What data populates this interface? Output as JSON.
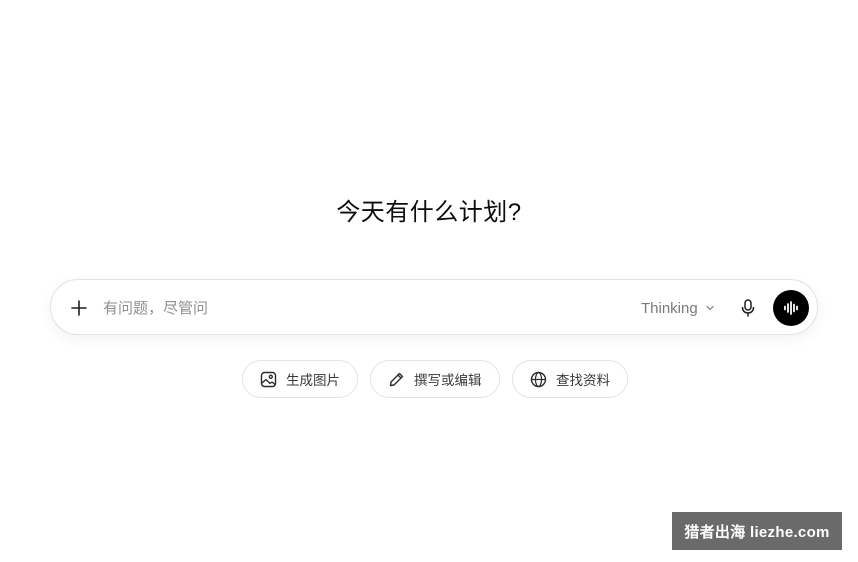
{
  "main": {
    "headline": "今天有什么计划?"
  },
  "composer": {
    "placeholder": "有问题，尽管问",
    "value": "",
    "model_label": "Thinking",
    "icons": {
      "add": "plus-icon",
      "model_dropdown": "chevron-down-icon",
      "dictate": "microphone-icon",
      "voice": "voice-waveform-icon"
    }
  },
  "suggestions": [
    {
      "label": "生成图片",
      "icon": "image-icon"
    },
    {
      "label": "撰写或编辑",
      "icon": "pencil-icon"
    },
    {
      "label": "查找资料",
      "icon": "globe-icon"
    }
  ],
  "watermark": {
    "text": "猎者出海 liezhe.com"
  },
  "colors": {
    "background": "#ffffff",
    "text": "#0d0d0d",
    "muted": "#8f8f8f",
    "border": "#e3e3e3",
    "voice_button": "#000000"
  }
}
